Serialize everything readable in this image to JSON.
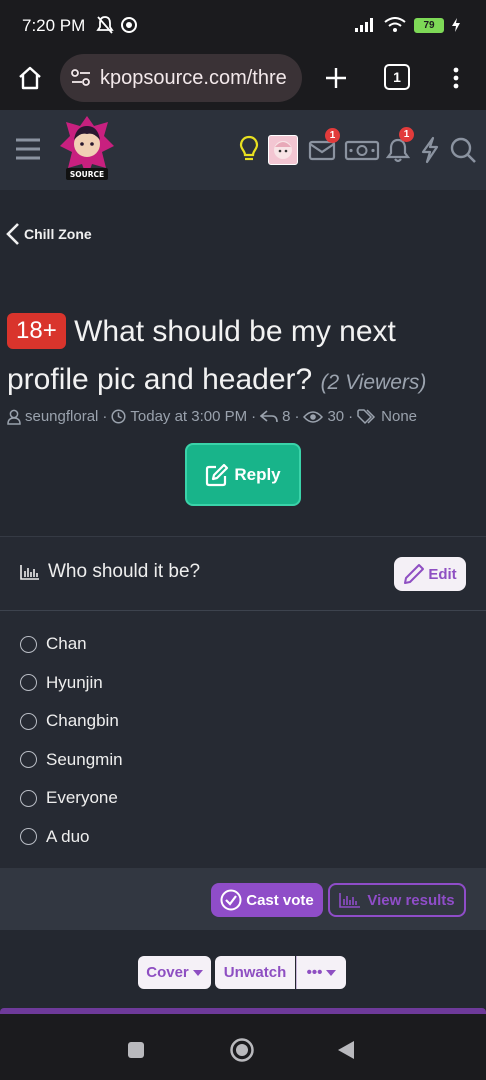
{
  "status": {
    "time": "7:20 PM",
    "battery": "79"
  },
  "browser": {
    "url": "kpopsource.com/thre",
    "tab_count": "1"
  },
  "site": {
    "logo_text": "SOURCE",
    "conversations_badge": "1",
    "alerts_badge": "1"
  },
  "breadcrumb": {
    "label": "Chill Zone"
  },
  "thread": {
    "prefix": "18+",
    "title": "What should be my next profile pic and header?",
    "viewers": "(2 Viewers)",
    "author": "seungfloral",
    "date": "Today at 3:00 PM",
    "replies": "8",
    "views": "30",
    "tags": "None",
    "reply_label": "Reply"
  },
  "poll": {
    "question": "Who should it be?",
    "edit_label": "Edit",
    "options": [
      "Chan",
      "Hyunjin",
      "Changbin",
      "Seungmin",
      "Everyone",
      "A duo"
    ],
    "cast_label": "Cast vote",
    "results_label": "View results"
  },
  "actions": {
    "cover": "Cover",
    "unwatch": "Unwatch",
    "more": "•••"
  },
  "colors": {
    "accent": "#8f4dc8",
    "reply": "#18b48a",
    "badge": "#e23b3b",
    "prefix": "#d9342c"
  }
}
